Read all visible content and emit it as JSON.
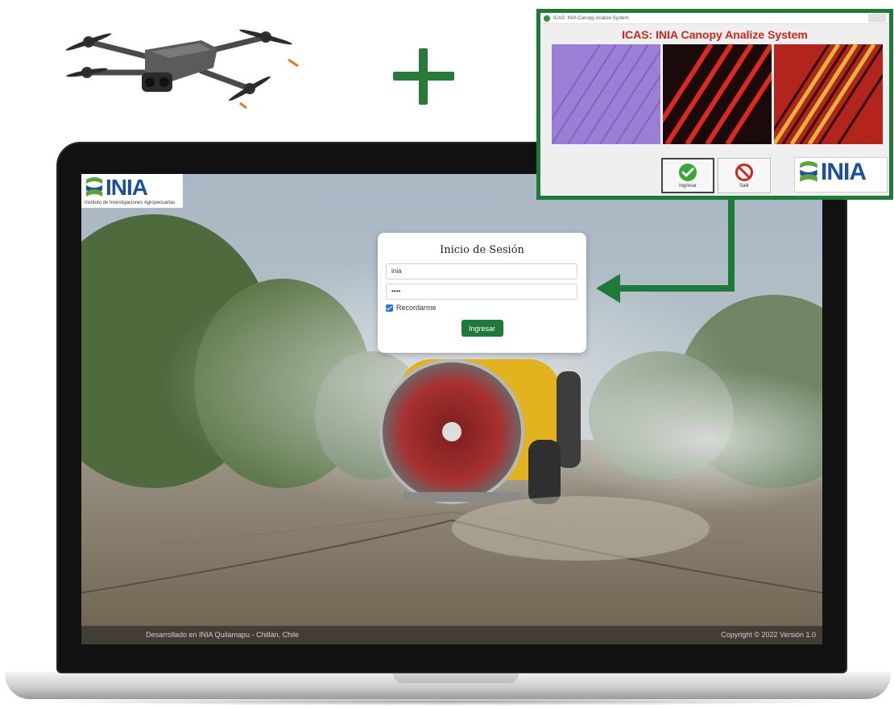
{
  "colors": {
    "brand_green": "#1f7a3a",
    "inia_blue": "#1c4f9c",
    "title_red": "#d4241c",
    "button_green": "#1d7a3a"
  },
  "plus_icon": "plus-icon",
  "login": {
    "title": "Inicio de Sesión",
    "username_value": "inia",
    "password_value": "••••",
    "remember_label": "Recordarme",
    "remember_checked": true,
    "submit_label": "Ingresar"
  },
  "logo": {
    "text": "INIA",
    "subtitle": "Instituto de Investigaciones Agropecuarias"
  },
  "footer": {
    "left": "Desarrollado en INIA Quilamapu - Chillán, Chile",
    "right": "Copyright © 2022 Versión 1.0"
  },
  "icas": {
    "window_title": "ICAS: INIA Canopy Analize System",
    "heading": "ICAS: INIA Canopy Analize System",
    "ingresar_label": "Ingresar",
    "salir_label": "Salir",
    "logo_text": "INIA"
  }
}
